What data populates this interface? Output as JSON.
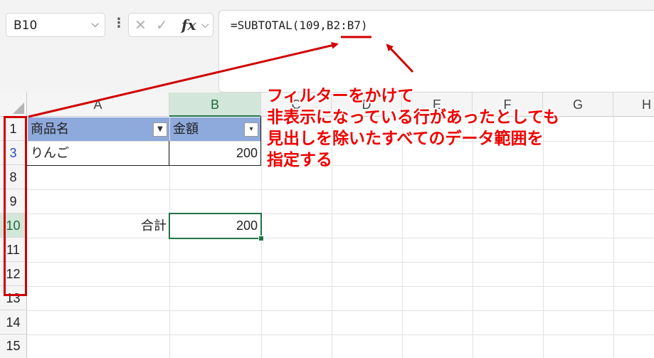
{
  "name_box": {
    "value": "B10"
  },
  "formula_bar": {
    "fx_label": "fx",
    "formula": "=SUBTOTAL(109,B2:B7)"
  },
  "columns": [
    "A",
    "B",
    "C",
    "D",
    "E",
    "F",
    "G",
    "H"
  ],
  "rows": [
    "1",
    "3",
    "8",
    "9",
    "10",
    "11",
    "12",
    "13",
    "14",
    "15"
  ],
  "table": {
    "headers": [
      "商品名",
      "金額"
    ],
    "row_3": {
      "name": "りんご",
      "amount": "200"
    }
  },
  "total": {
    "label": "合計",
    "value": "200"
  },
  "annotation": {
    "lines": [
      "フィルターをかけて",
      "非表示になっている行があったとしても",
      "見出しを除いたすべてのデータ範囲を",
      "指定する"
    ]
  },
  "colors": {
    "accent": "#217346",
    "annotation": "#ee0000",
    "table_header": "#8ea9db"
  },
  "icons": [
    "chevron-down-icon",
    "more-dots-icon",
    "cancel-x-icon",
    "check-icon",
    "fx-icon",
    "filter-icon",
    "filter-dropdown-icon"
  ]
}
